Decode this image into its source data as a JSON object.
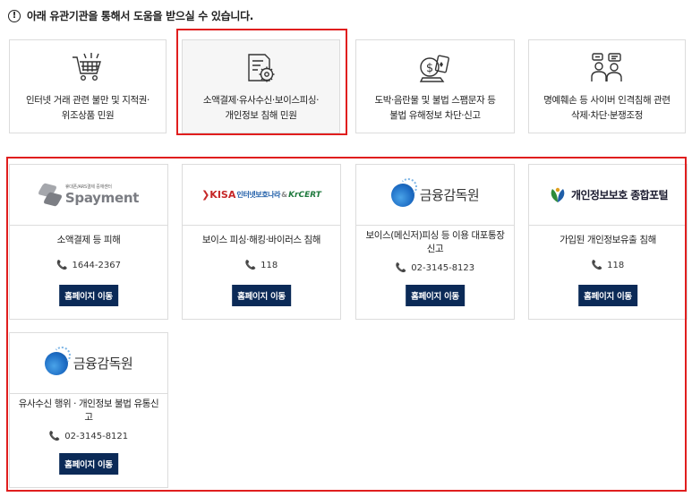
{
  "notice": {
    "icon": "exclamation-circle-icon",
    "text": "아래 유관기관을 통해서 도움을 받으실 수 있습니다."
  },
  "categories": [
    {
      "icon": "shopping-cart-icon",
      "label": "인터넷 거래 관련 불만 및 지적권·\n위조상품 민원",
      "selected": false
    },
    {
      "icon": "document-gear-icon",
      "label": "소액결제·유사수신·보이스피싱·\n개인정보 침해 민원",
      "selected": true
    },
    {
      "icon": "money-gambling-icon",
      "label": "도박·음란물 및 불법 스팸문자 등\n불법 유해정보 차단·신고",
      "selected": false
    },
    {
      "icon": "people-chat-icon",
      "label": "명예훼손 등 사이버 인격침해 관련\n삭제·차단·분쟁조정",
      "selected": false
    }
  ],
  "agencies": [
    {
      "logo": {
        "kind": "spayment",
        "small": "휴대폰/ARS결제 중재센터",
        "big": "Spayment"
      },
      "title": "소액결제 등 피해",
      "phone": "1644-2367",
      "button": "홈페이지 이동"
    },
    {
      "logo": {
        "kind": "kisa",
        "mark": "❯KISA",
        "sub": "인터넷보호나라",
        "amp": "&",
        "cert": "KrCERT"
      },
      "title": "보이스 피싱·해킹·바이러스 침해",
      "phone": "118",
      "button": "홈페이지 이동"
    },
    {
      "logo": {
        "kind": "fss",
        "name": "금융감독원"
      },
      "title": "보이스(메신저)피싱 등 이용 대포통장 신고",
      "phone": "02-3145-8123",
      "button": "홈페이지 이동"
    },
    {
      "logo": {
        "kind": "privacy",
        "name": "개인정보보호 종합포털"
      },
      "title": "가입된 개인정보유출 침해",
      "phone": "118",
      "button": "홈페이지 이동"
    },
    {
      "logo": {
        "kind": "fss",
        "name": "금융감독원"
      },
      "title": "유사수신 행위 · 개인정보 불법 유통신고",
      "phone": "02-3145-8121",
      "button": "홈페이지 이동"
    }
  ],
  "colors": {
    "highlight": "#e01e1e",
    "button_bg": "#0b2a57",
    "border": "#dcdcdc"
  }
}
